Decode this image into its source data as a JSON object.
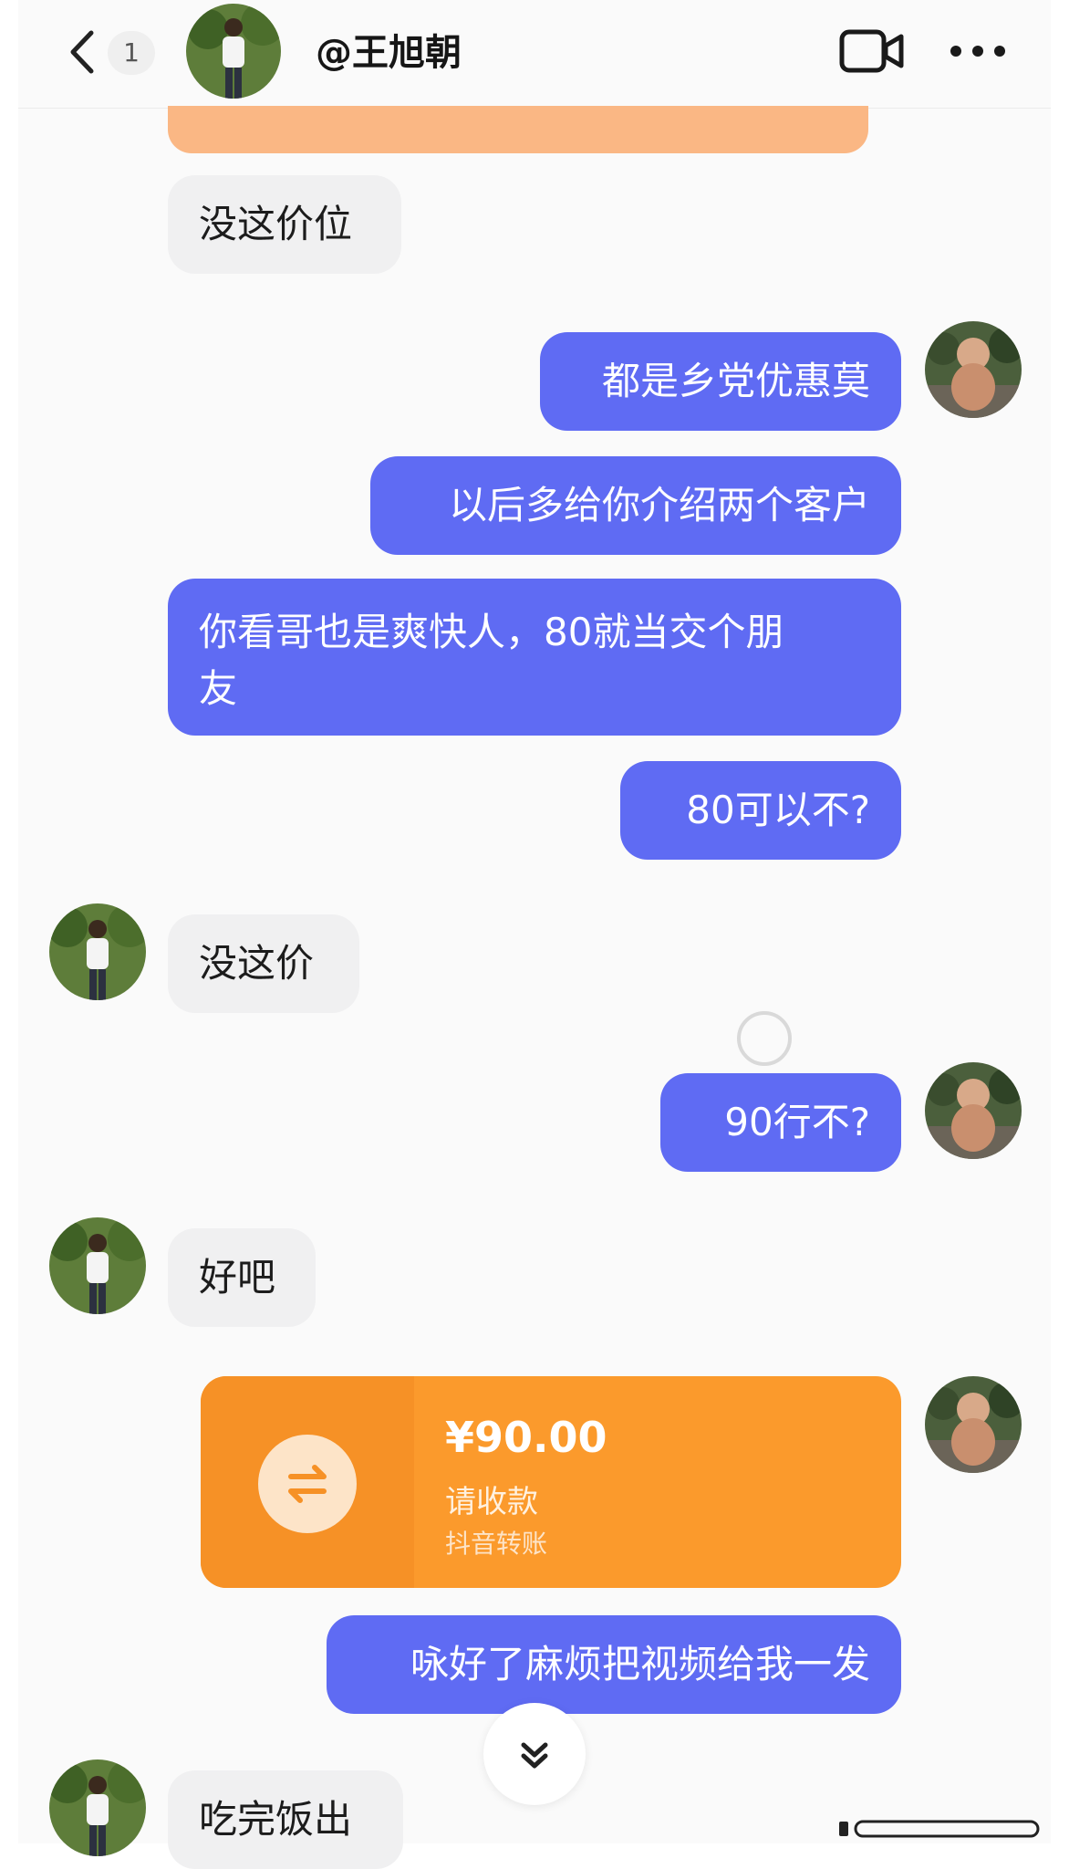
{
  "header": {
    "unread_count": "1",
    "contact_name": "@王旭朝"
  },
  "messages": [
    {
      "side": "received",
      "text": "没这价位"
    },
    {
      "side": "sent",
      "text": "都是乡党优惠莫"
    },
    {
      "side": "sent",
      "text": "以后多给你介绍两个客户"
    },
    {
      "side": "sent",
      "text_line1": "你看哥也是爽快人，80就当交个朋",
      "text_line2": "友"
    },
    {
      "side": "sent",
      "text": "80可以不?"
    },
    {
      "side": "received",
      "text": "没这价"
    },
    {
      "side": "sent",
      "text": "90行不?"
    },
    {
      "side": "received",
      "text": "好吧"
    },
    {
      "side": "sent",
      "text": "咏好了麻烦把视频给我一发"
    },
    {
      "side": "received",
      "text": "吃完饭出"
    }
  ],
  "payment": {
    "amount": "¥90.00",
    "label": "请收款",
    "source": "抖音转账"
  },
  "colors": {
    "sent_bubble": "#5f6bf3",
    "received_bubble": "#f0f0f1",
    "payment_card": "#fb9a2c"
  },
  "icons": [
    "back-icon",
    "video-call-icon",
    "more-icon",
    "transfer-icon",
    "scroll-down-icon"
  ]
}
